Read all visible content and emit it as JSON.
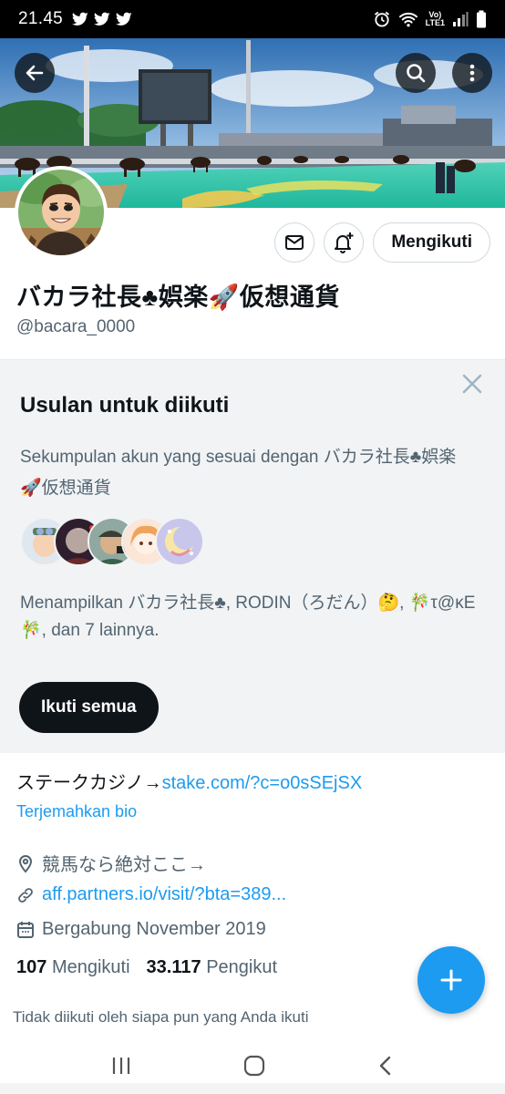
{
  "status": {
    "time": "21.45",
    "lte_top": "Vo)",
    "lte_bottom": "LTE1"
  },
  "header": {
    "back_icon": "arrow-left-icon",
    "search_icon": "search-icon",
    "more_icon": "more-vertical-icon"
  },
  "profile": {
    "name": "バカラ社長♣娯楽🚀仮想通貨",
    "handle": "@bacara_0000",
    "follow_state_label": "Mengikuti",
    "bio_prefix": "ステークカジノ→",
    "bio_link": "stake.com/?c=o0sSEjSX",
    "translate_label": "Terjemahkan bio",
    "location": "競馬なら絶対ここ→",
    "website": "aff.partners.io/visit/?bta=389...",
    "joined": "Bergabung November 2019",
    "following_count": "107",
    "following_label": "Mengikuti",
    "followers_count": "33.117",
    "followers_label": "Pengikut",
    "followed_by_note": "Tidak diikuti oleh siapa pun yang Anda ikuti"
  },
  "suggestions": {
    "title": "Usulan untuk diikuti",
    "description": "Sekumpulan akun yang sesuai dengan バカラ社長♣娯楽🚀仮想通貨",
    "names_text": "Menampilkan バカラ社長♣, RODIN（ろだん）🤔, 🎋τ@κΕ🎋, dan 7 lainnya.",
    "follow_all_label": "Ikuti semua"
  },
  "colors": {
    "accent": "#1d9bf0",
    "text": "#0f1419",
    "muted": "#536471",
    "panel": "#f1f3f5"
  }
}
